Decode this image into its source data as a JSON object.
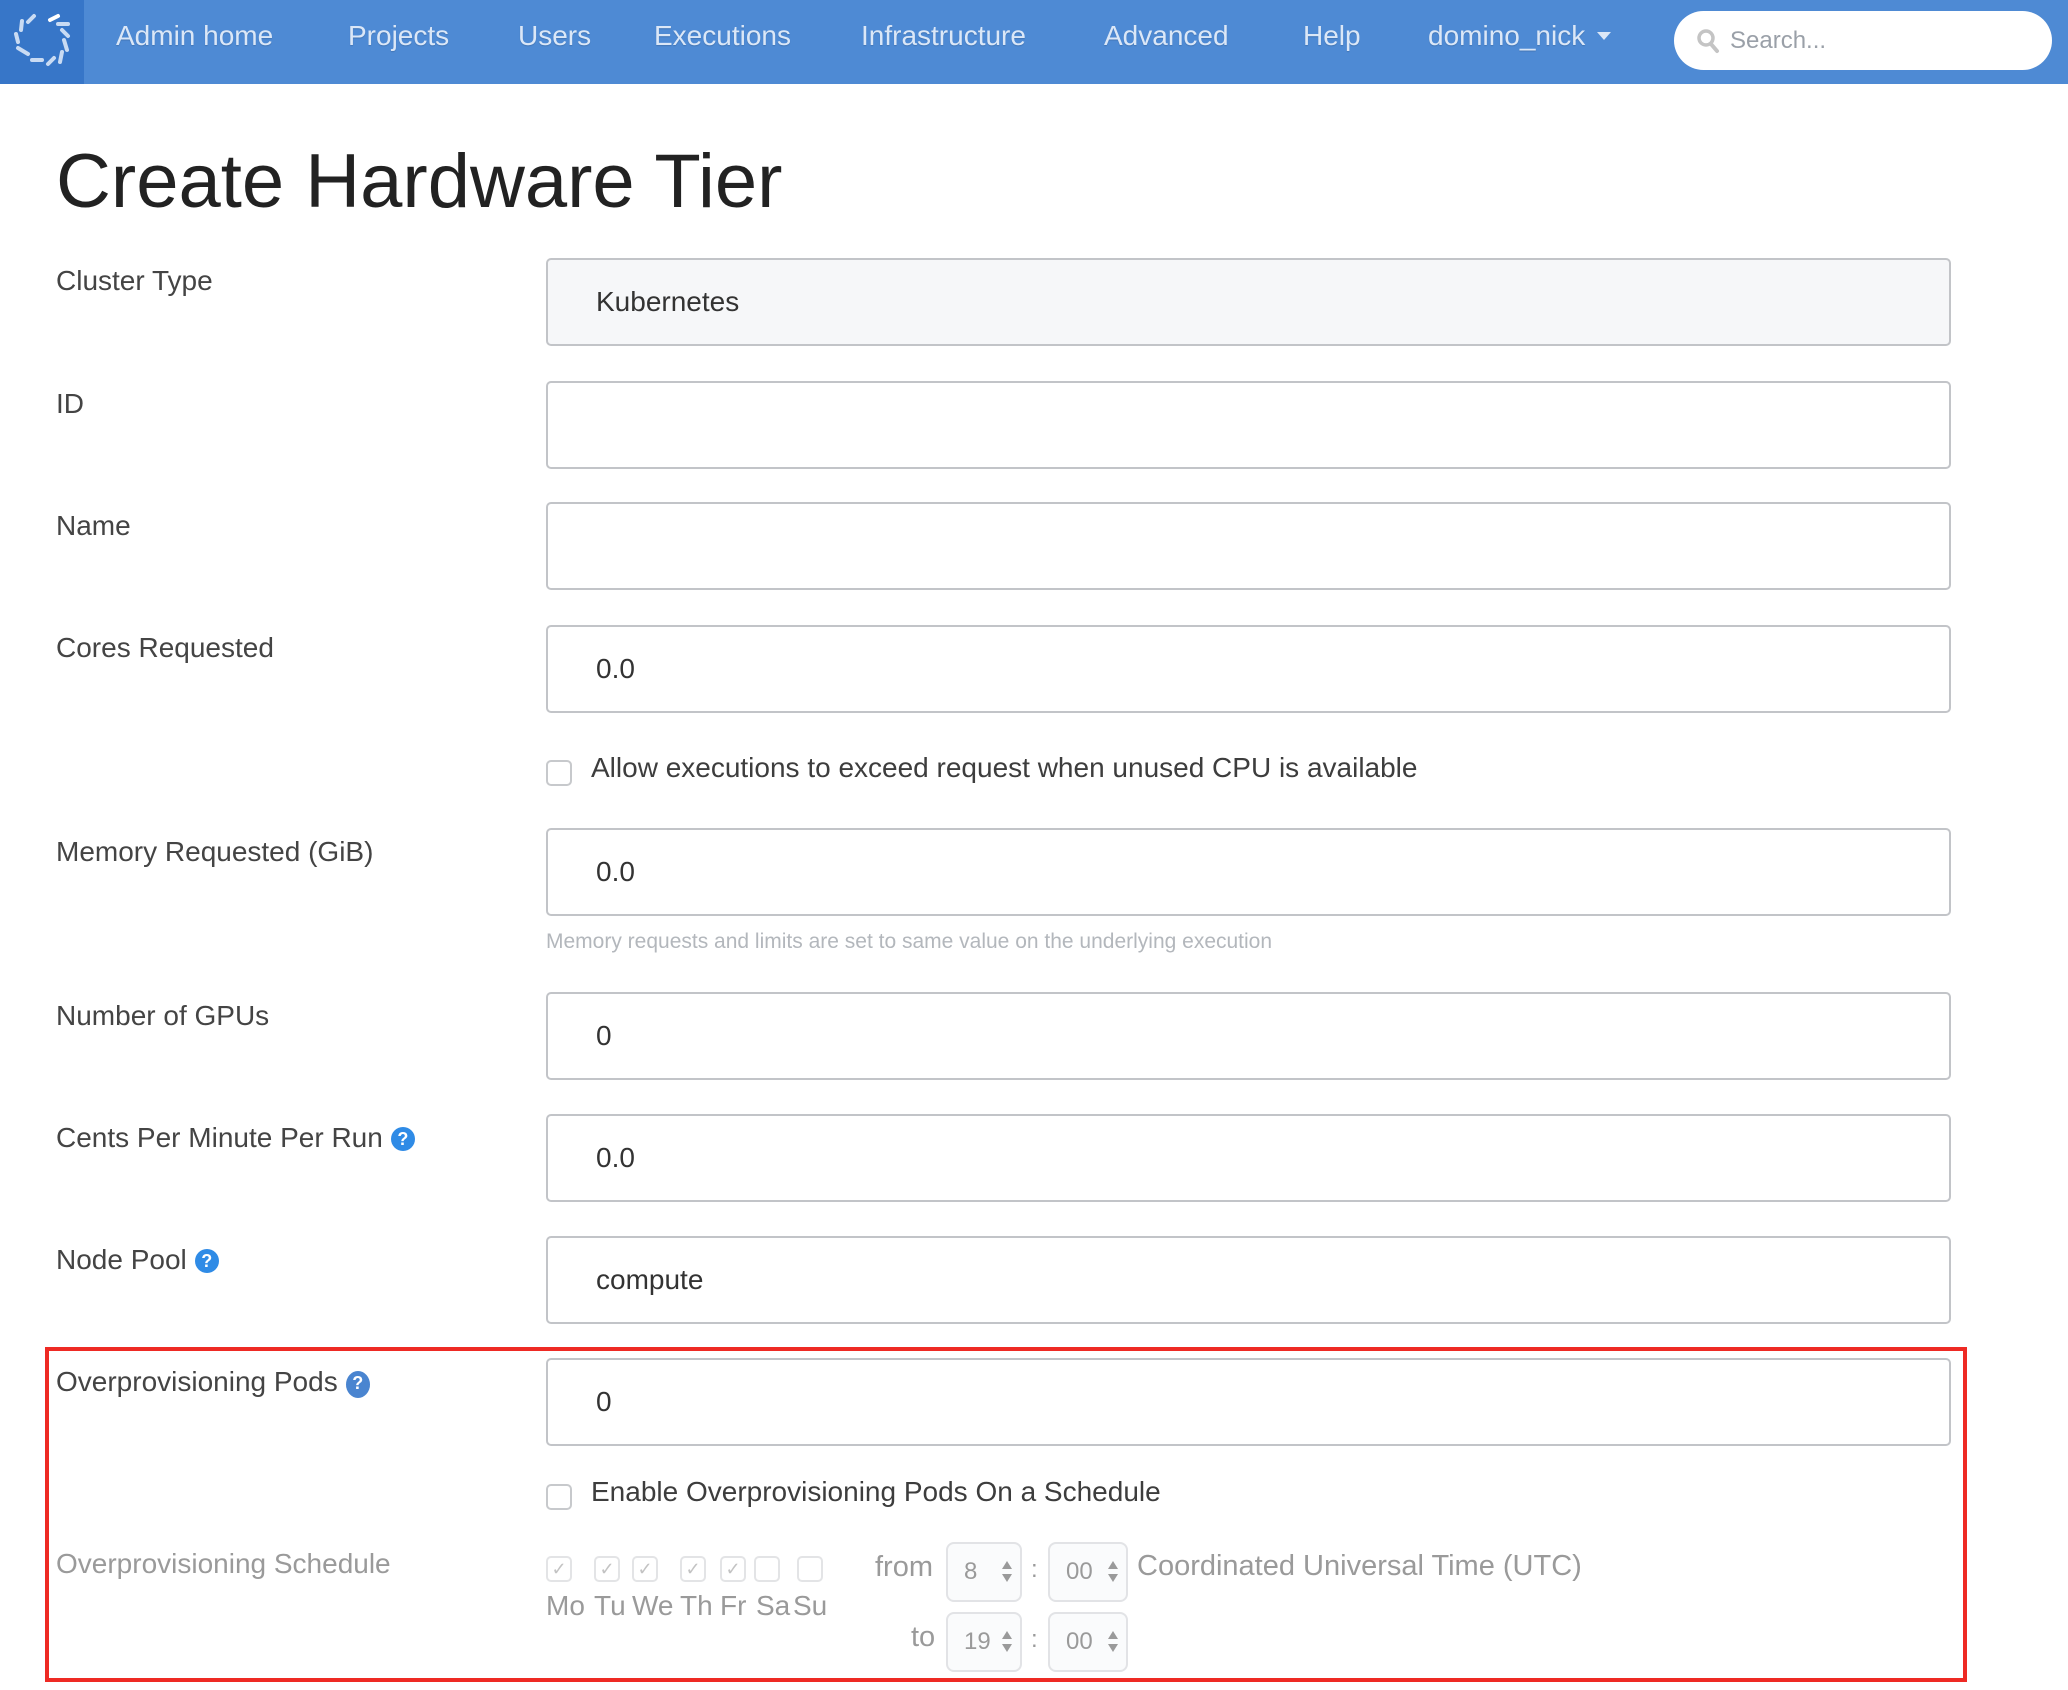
{
  "nav": {
    "items": [
      {
        "label": "Admin home"
      },
      {
        "label": "Projects"
      },
      {
        "label": "Users"
      },
      {
        "label": "Executions"
      },
      {
        "label": "Infrastructure"
      },
      {
        "label": "Advanced"
      },
      {
        "label": "Help"
      }
    ],
    "user": "domino_nick",
    "search_placeholder": "Search...",
    "brand_color": "#4e8ad4"
  },
  "page": {
    "title": "Create Hardware Tier"
  },
  "form": {
    "cluster_type": {
      "label": "Cluster Type",
      "value": "Kubernetes"
    },
    "id": {
      "label": "ID",
      "value": ""
    },
    "name": {
      "label": "Name",
      "value": ""
    },
    "cores": {
      "label": "Cores Requested",
      "value": "0.0"
    },
    "allow_exceed": {
      "label": "Allow executions to exceed request when unused CPU is available",
      "checked": false
    },
    "memory": {
      "label": "Memory Requested (GiB)",
      "value": "0.0",
      "hint": "Memory requests and limits are set to same value on the underlying execution"
    },
    "gpus": {
      "label": "Number of GPUs",
      "value": "0"
    },
    "cents": {
      "label": "Cents Per Minute Per Run",
      "value": "0.0"
    },
    "node_pool": {
      "label": "Node Pool",
      "value": "compute"
    },
    "overprov_pods": {
      "label": "Overprovisioning Pods",
      "value": "0"
    },
    "enable_schedule": {
      "label": "Enable Overprovisioning Pods On a Schedule",
      "checked": false
    },
    "schedule": {
      "label": "Overprovisioning Schedule",
      "days": [
        {
          "label": "Mo",
          "checked": true
        },
        {
          "label": "Tu",
          "checked": true
        },
        {
          "label": "We",
          "checked": true
        },
        {
          "label": "Th",
          "checked": true
        },
        {
          "label": "Fr",
          "checked": true
        },
        {
          "label": "Sa",
          "checked": false
        },
        {
          "label": "Su",
          "checked": false
        }
      ],
      "from_label": "from",
      "to_label": "to",
      "from_hour": "8",
      "from_minute": "00",
      "to_hour": "19",
      "to_minute": "00",
      "separator": ":",
      "timezone": "Coordinated Universal Time (UTC)"
    }
  },
  "help_glyph": "?",
  "check_glyph": "✓",
  "highlight_color": "#ee2a24"
}
